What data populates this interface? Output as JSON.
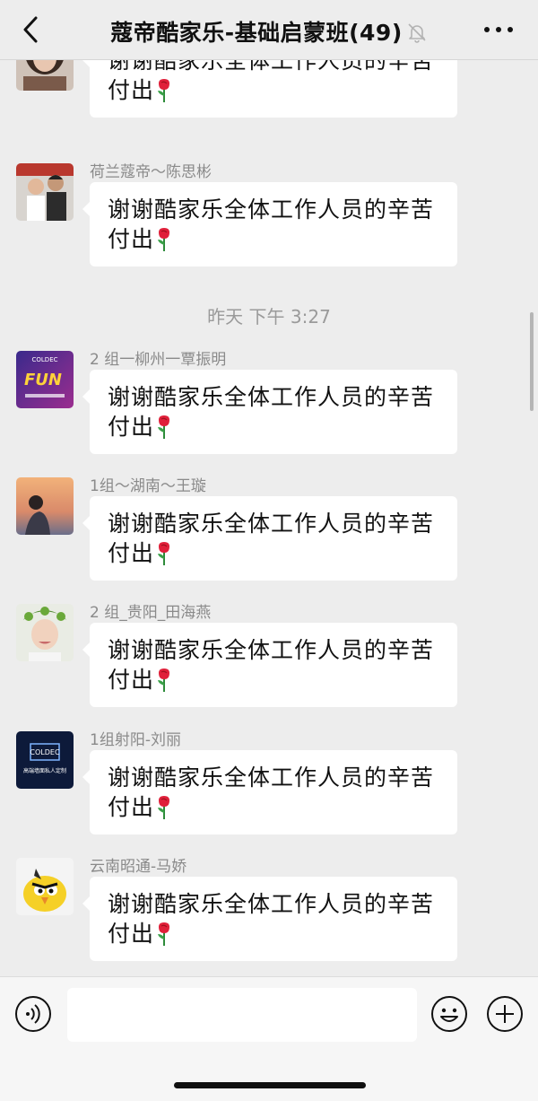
{
  "header": {
    "title": "蔻帝酷家乐-基础启蒙班",
    "member_count": "(49)",
    "back_icon": "chevron-left-icon",
    "mute_icon": "bell-muted-icon",
    "more_icon": "more-dots-icon"
  },
  "messages": [
    {
      "sender": "",
      "text": "谢谢酷家乐全体工作人员的辛苦付出",
      "emoji": "rose"
    },
    {
      "sender": "荷兰蔻帝～陈思彬",
      "text": "谢谢酷家乐全体工作人员的辛苦付出",
      "emoji": "rose"
    },
    {
      "sender": "2 组一柳州一覃振明",
      "text": "谢谢酷家乐全体工作人员的辛苦付出",
      "emoji": "rose"
    },
    {
      "sender": "1组～湖南～王璇",
      "text": "谢谢酷家乐全体工作人员的辛苦付出",
      "emoji": "rose"
    },
    {
      "sender": "2 组_贵阳_田海燕",
      "text": "谢谢酷家乐全体工作人员的辛苦付出",
      "emoji": "rose"
    },
    {
      "sender": "1组射阳-刘丽",
      "text": "谢谢酷家乐全体工作人员的辛苦付出",
      "emoji": "rose"
    },
    {
      "sender": "云南昭通-马娇",
      "text": "谢谢酷家乐全体工作人员的辛苦付出",
      "emoji": "rose"
    }
  ],
  "timestamp": "昨天 下午 3:27",
  "avatars": {
    "a3_line1": "COLDEC",
    "a3_line2": "FUN",
    "a6_line1": "COLDEC",
    "a6_line2": "高端墙面私人定制"
  },
  "input_bar": {
    "placeholder": "",
    "voice_icon": "voice-icon",
    "emoji_icon": "emoji-icon",
    "add_icon": "plus-circle-icon"
  },
  "colors": {
    "background": "#ededed",
    "bubble": "#ffffff",
    "sender_text": "#8a8a8a"
  }
}
